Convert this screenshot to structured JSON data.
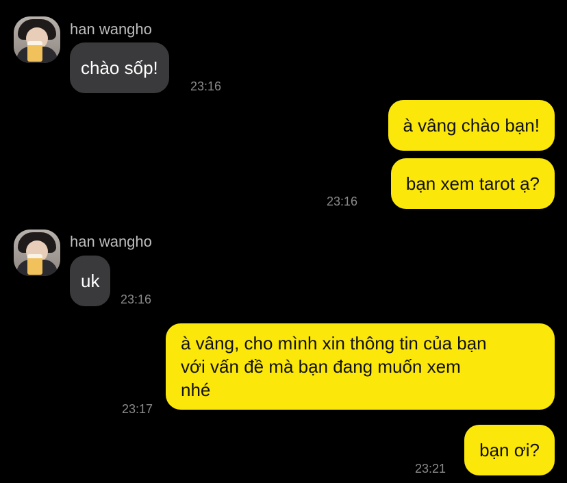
{
  "messages": [
    {
      "sender": "han wangho",
      "side": "in",
      "text": "chào sốp!",
      "time": "23:16"
    },
    {
      "side": "out",
      "text": "à vâng chào bạn!"
    },
    {
      "side": "out",
      "text": "bạn xem tarot ạ?",
      "time": "23:16"
    },
    {
      "sender": "han wangho",
      "side": "in",
      "text": "uk",
      "time": "23:16"
    },
    {
      "side": "out",
      "lines": [
        "à vâng, cho mình xin thông tin của bạn",
        "với vấn đề mà bạn đang muốn xem",
        "nhé"
      ],
      "time": "23:17"
    },
    {
      "side": "out",
      "text": "bạn ơi?",
      "time": "23:21"
    }
  ],
  "colors": {
    "background": "#000000",
    "incoming_bubble": "#3a3a3c",
    "outgoing_bubble": "#fbe70a"
  }
}
